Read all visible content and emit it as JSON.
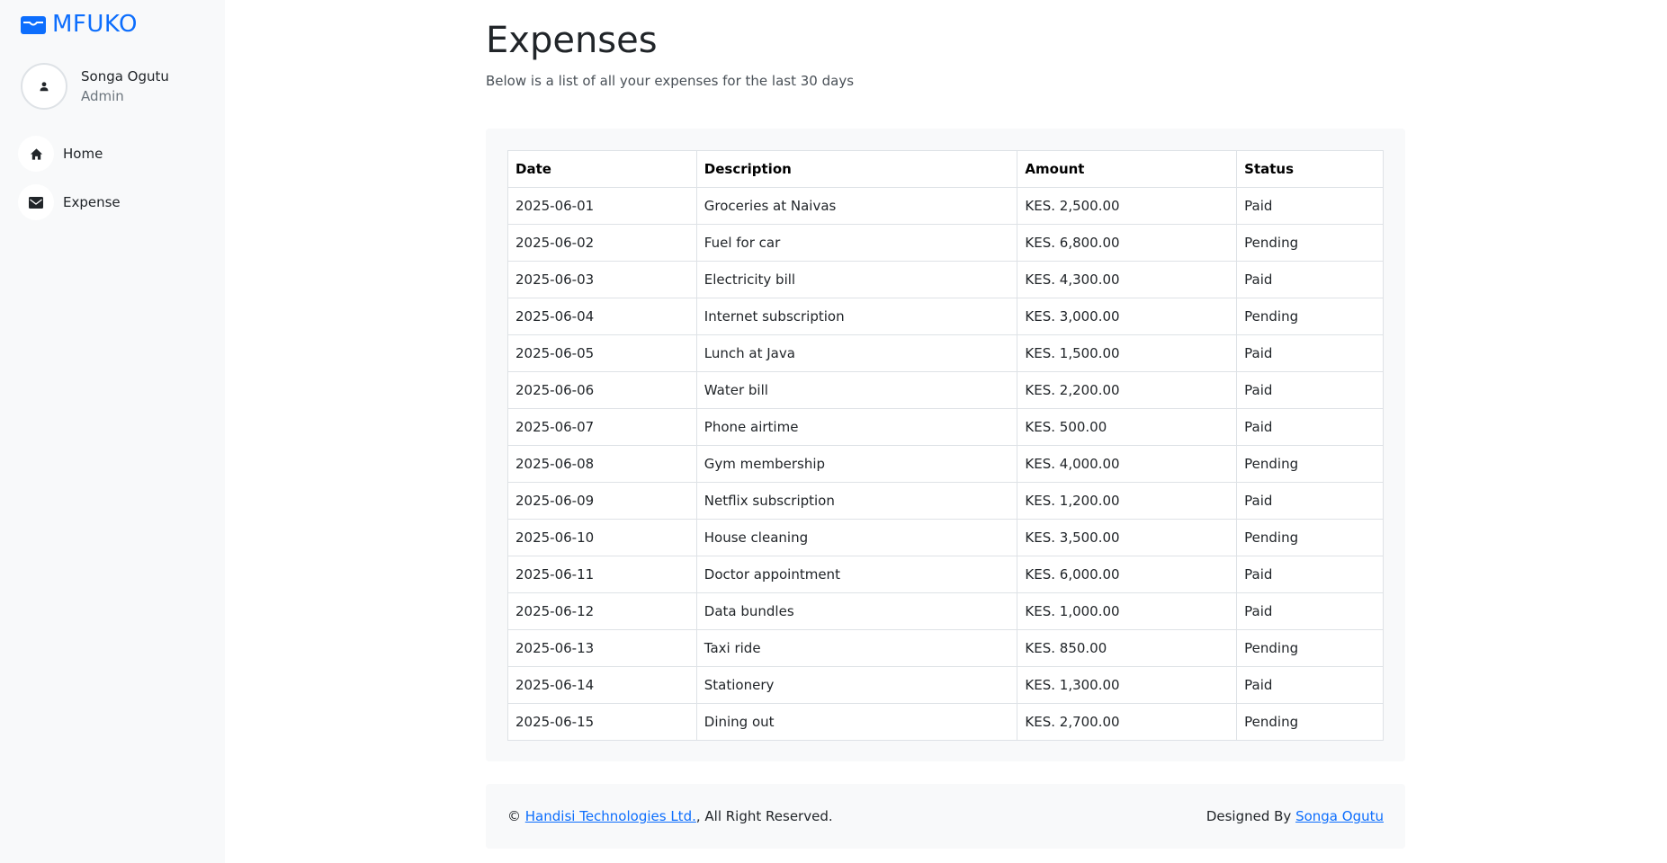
{
  "brand": {
    "name": "MFUKO",
    "icon": "wallet-icon",
    "color": "#0d6efd"
  },
  "user": {
    "name": "Songa Ogutu",
    "role": "Admin",
    "avatar_icon": "person-icon"
  },
  "nav": {
    "items": [
      {
        "label": "Home",
        "icon": "house-icon"
      },
      {
        "label": "Expense",
        "icon": "envelope-icon"
      }
    ]
  },
  "page": {
    "title": "Expenses",
    "subtitle": "Below is a list of all your expenses for the last 30 days"
  },
  "table": {
    "headers": [
      "Date",
      "Description",
      "Amount",
      "Status"
    ],
    "rows": [
      [
        "2025-06-01",
        "Groceries at Naivas",
        "KES. 2,500.00",
        "Paid"
      ],
      [
        "2025-06-02",
        "Fuel for car",
        "KES. 6,800.00",
        "Pending"
      ],
      [
        "2025-06-03",
        "Electricity bill",
        "KES. 4,300.00",
        "Paid"
      ],
      [
        "2025-06-04",
        "Internet subscription",
        "KES. 3,000.00",
        "Pending"
      ],
      [
        "2025-06-05",
        "Lunch at Java",
        "KES. 1,500.00",
        "Paid"
      ],
      [
        "2025-06-06",
        "Water bill",
        "KES. 2,200.00",
        "Paid"
      ],
      [
        "2025-06-07",
        "Phone airtime",
        "KES. 500.00",
        "Paid"
      ],
      [
        "2025-06-08",
        "Gym membership",
        "KES. 4,000.00",
        "Pending"
      ],
      [
        "2025-06-09",
        "Netflix subscription",
        "KES. 1,200.00",
        "Paid"
      ],
      [
        "2025-06-10",
        "House cleaning",
        "KES. 3,500.00",
        "Pending"
      ],
      [
        "2025-06-11",
        "Doctor appointment",
        "KES. 6,000.00",
        "Paid"
      ],
      [
        "2025-06-12",
        "Data bundles",
        "KES. 1,000.00",
        "Paid"
      ],
      [
        "2025-06-13",
        "Taxi ride",
        "KES. 850.00",
        "Pending"
      ],
      [
        "2025-06-14",
        "Stationery",
        "KES. 1,300.00",
        "Paid"
      ],
      [
        "2025-06-15",
        "Dining out",
        "KES. 2,700.00",
        "Pending"
      ]
    ]
  },
  "footer": {
    "copyright_symbol": "©",
    "company_link": "Handisi Technologies Ltd.",
    "rights_text": ", All Right Reserved.",
    "designed_by_text": "Designed By",
    "designer_link": "Songa Ogutu"
  }
}
